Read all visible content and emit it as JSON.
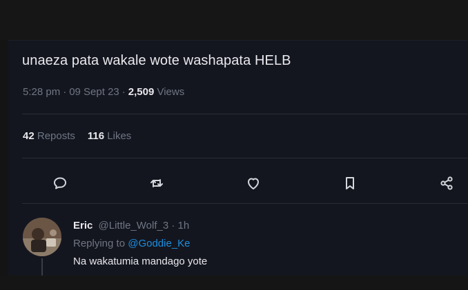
{
  "tweet": {
    "text": "unaeza pata wakale wote washapata HELB",
    "time": "5:28 pm",
    "date": "09 Sept 23",
    "separator": "·",
    "views_count": "2,509",
    "views_label": "Views",
    "reposts_count": "42",
    "reposts_label": "Reposts",
    "likes_count": "116",
    "likes_label": "Likes"
  },
  "actions": {
    "icons": [
      "reply-icon",
      "repost-icon",
      "like-icon",
      "bookmark-icon",
      "share-icon"
    ]
  },
  "reply": {
    "name": "Eric",
    "handle": "@Little_Wolf_3",
    "separator": "·",
    "age": "1h",
    "replying_label": "Replying to",
    "replying_to": "@Goddie_Ke",
    "text": "Na wakatumia mandago yote"
  },
  "colors": {
    "background": "#14161f",
    "text": "#e9e9ee",
    "muted": "#6e7683",
    "mention": "#1d8fe0"
  }
}
